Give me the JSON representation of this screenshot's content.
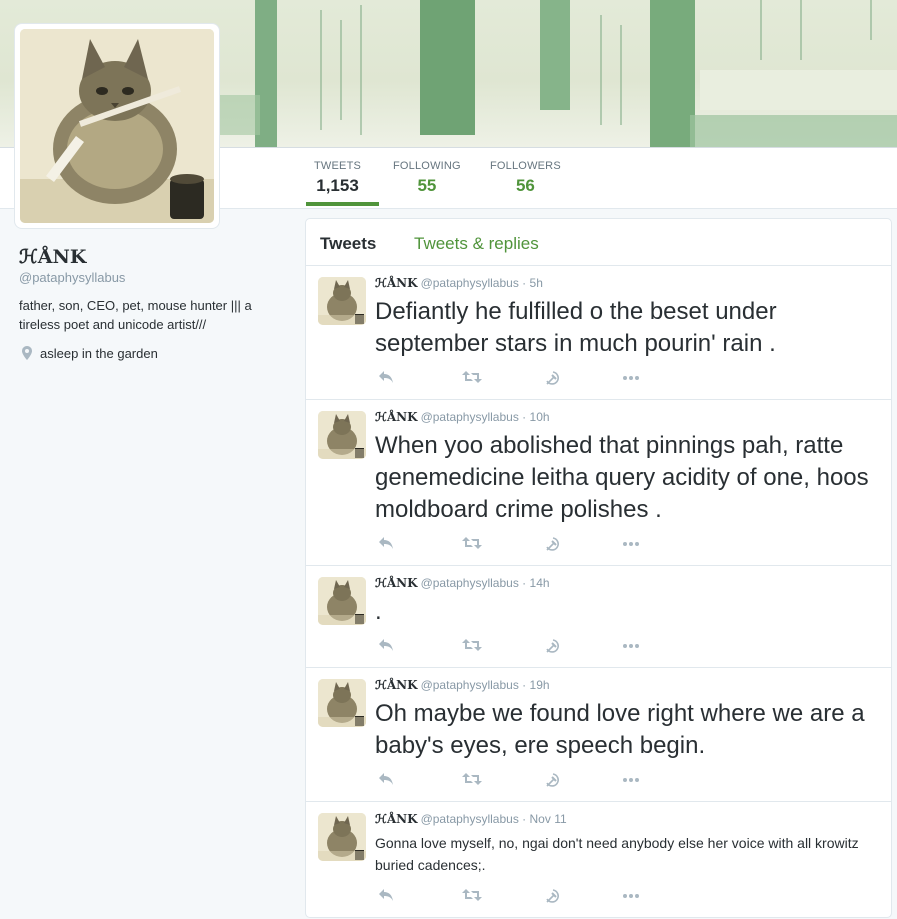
{
  "colors": {
    "accent": "#50943b",
    "muted": "#8899a6",
    "text": "#292f33",
    "icon": "#aab8c2"
  },
  "profile": {
    "name": "ℋÅNK",
    "handle": "@pataphysyllabus",
    "bio": "father, son, CEO, pet, mouse hunter ||| a tireless poet and unicode artist///",
    "location": "asleep in the garden"
  },
  "nav": {
    "tweets": {
      "label": "TWEETS",
      "value": "1,153"
    },
    "following": {
      "label": "FOLLOWING",
      "value": "55"
    },
    "followers": {
      "label": "FOLLOWERS",
      "value": "56"
    }
  },
  "timeline": {
    "tabs": [
      "Tweets",
      "Tweets & replies"
    ],
    "tweets": [
      {
        "name": "ℋÅNK",
        "handle": "@pataphysyllabus",
        "sep": "·",
        "time": "5h",
        "text": "Defiantly he fulfilled o the beset under september stars in much pourin' rain ."
      },
      {
        "name": "ℋÅNK",
        "handle": "@pataphysyllabus",
        "sep": "·",
        "time": "10h",
        "text": "When yoo abolished that pinnings pah, ratte genemedicine leitha query acidity of one, hoos moldboard crime polishes  ."
      },
      {
        "name": "ℋÅNK",
        "handle": "@pataphysyllabus",
        "sep": "·",
        "time": "14h",
        "text": "."
      },
      {
        "name": "ℋÅNK",
        "handle": "@pataphysyllabus",
        "sep": "·",
        "time": "19h",
        "text": "Oh maybe we found love right where we are a baby's eyes, ere speech begin."
      },
      {
        "name": "ℋÅNK",
        "handle": "@pataphysyllabus",
        "sep": "·",
        "time": "Nov 11",
        "text": "Gonna love myself, no, ngai don't need anybody else  her voice with all krowitz buried cadences;."
      }
    ]
  },
  "icons": {
    "reply": "reply-icon",
    "retweet": "retweet-icon",
    "favorite": "hammer-sickle-icon",
    "more": "more-icon",
    "location": "location-pin-icon"
  }
}
